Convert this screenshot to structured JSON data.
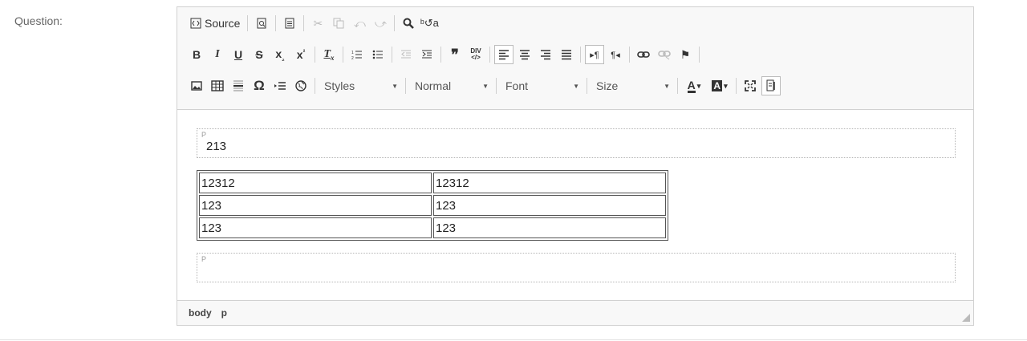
{
  "form": {
    "question_label": "Question:"
  },
  "toolbar": {
    "source_label": "Source",
    "styles": {
      "value": "Styles"
    },
    "format": {
      "value": "Normal"
    },
    "font": {
      "value": "Font"
    },
    "size": {
      "value": "Size"
    }
  },
  "content": {
    "paragraph1": {
      "tag": "P",
      "text": "213"
    },
    "table": {
      "rows": [
        [
          "12312",
          "12312"
        ],
        [
          "123",
          "123"
        ],
        [
          "123",
          "123"
        ]
      ]
    },
    "paragraph2": {
      "tag": "P",
      "text": ""
    }
  },
  "statusbar": {
    "path": [
      "body",
      "p"
    ]
  }
}
